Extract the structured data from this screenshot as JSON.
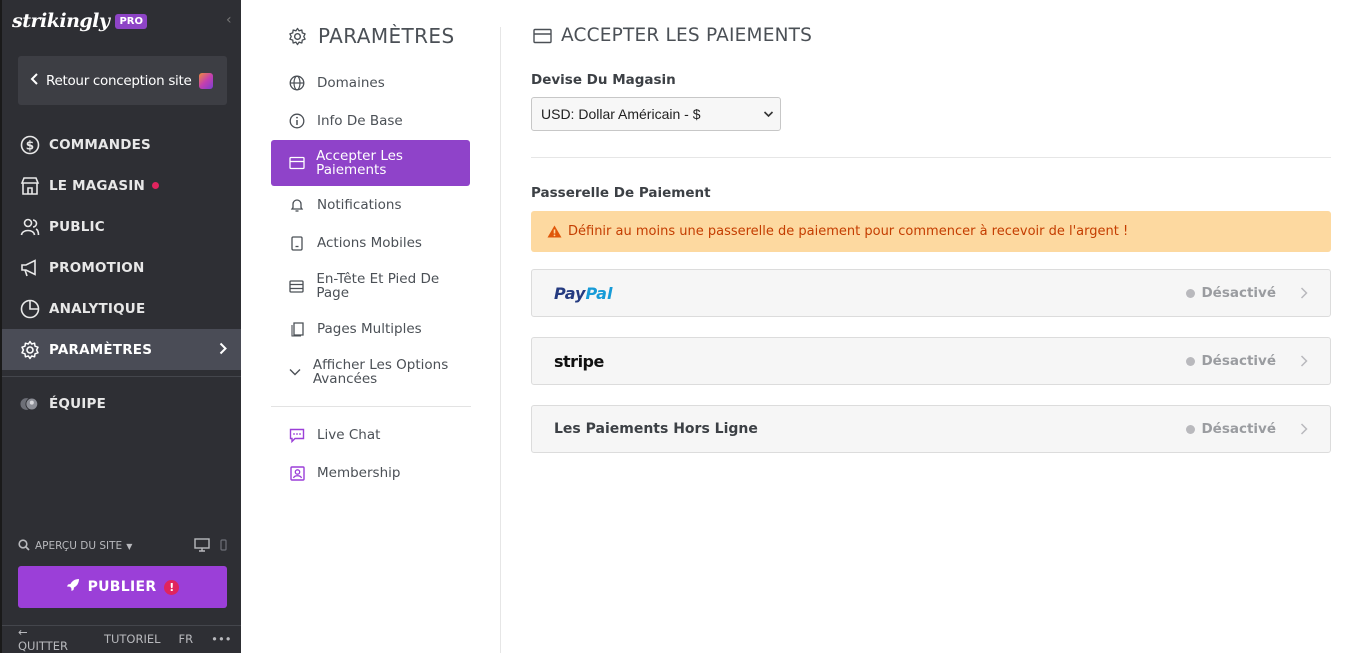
{
  "sidebar": {
    "logo": "strikingly",
    "badge": "PRO",
    "back_label": "Retour conception site",
    "nav": [
      {
        "label": "COMMANDES",
        "icon": "dollar-circle-icon"
      },
      {
        "label": "LE MAGASIN",
        "icon": "store-icon",
        "notification": true
      },
      {
        "label": "PUBLIC",
        "icon": "users-icon"
      },
      {
        "label": "PROMOTION",
        "icon": "megaphone-icon"
      },
      {
        "label": "ANALYTIQUE",
        "icon": "pie-chart-icon"
      },
      {
        "label": "PARAMÈTRES",
        "icon": "gear-icon",
        "active": true
      },
      {
        "label": "ÉQUIPE",
        "icon": "team-icon"
      }
    ],
    "preview_label": "APERÇU DU SITE",
    "publish_label": "PUBLIER",
    "publish_alert": "!",
    "footer": {
      "quit": "QUITTER",
      "tutorial": "TUTORIEL",
      "lang": "FR",
      "more": "•••"
    }
  },
  "settings": {
    "title": "PARAMÈTRES",
    "items": [
      {
        "label": "Domaines",
        "icon": "globe-icon"
      },
      {
        "label": "Info De Base",
        "icon": "info-icon"
      },
      {
        "label": "Accepter Les Paiements",
        "icon": "card-icon",
        "active": true
      },
      {
        "label": "Notifications",
        "icon": "bell-icon"
      },
      {
        "label": "Actions Mobiles",
        "icon": "mobile-icon"
      },
      {
        "label": "En-Tête Et Pied De Page",
        "icon": "layout-icon"
      },
      {
        "label": "Pages Multiples",
        "icon": "pages-icon"
      },
      {
        "label": "Afficher Les Options Avancées",
        "icon": "chevron-down-icon"
      }
    ],
    "extras": [
      {
        "label": "Live Chat",
        "icon": "chat-icon"
      },
      {
        "label": "Membership",
        "icon": "membership-icon"
      }
    ]
  },
  "main": {
    "title": "ACCEPTER LES PAIEMENTS",
    "currency_label": "Devise Du Magasin",
    "currency_value": "USD: Dollar Américain - $",
    "gateway_label": "Passerelle De Paiement",
    "warning": "Définir au moins une passerelle de paiement pour commencer à recevoir de l'argent !",
    "gateways": [
      {
        "name_a": "Pay",
        "name_b": "Pal",
        "status": "Désactivé"
      },
      {
        "name": "stripe",
        "status": "Désactivé"
      },
      {
        "name": "Les Paiements Hors Ligne",
        "status": "Désactivé"
      }
    ]
  },
  "colors": {
    "accent": "#8f43c9",
    "sidebar_bg": "#2e2f34",
    "warning_bg": "#fdd9a0",
    "warning_text": "#c43d00"
  }
}
